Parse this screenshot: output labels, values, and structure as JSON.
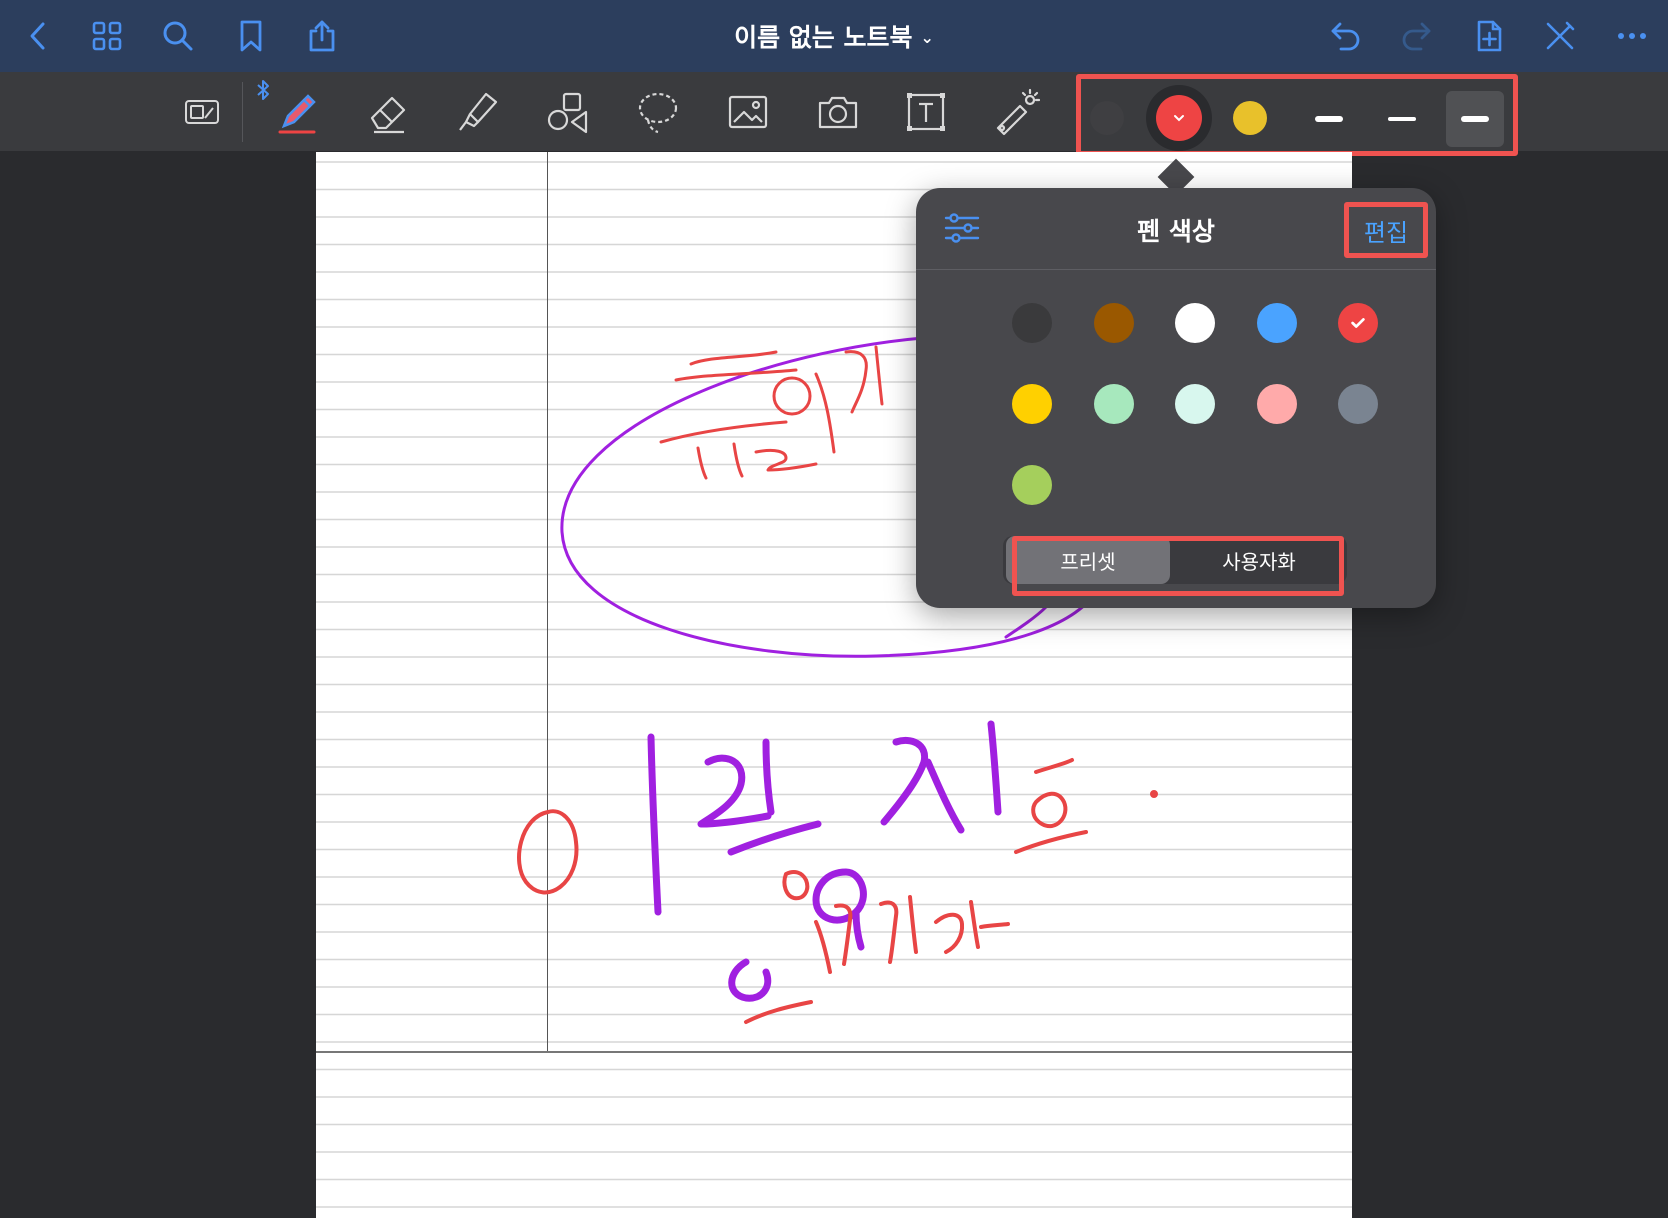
{
  "navbar": {
    "title": "이름 없는 노트북",
    "title_chevron": "⌄",
    "accent_color": "#4a90f0",
    "left_icons": [
      "back-chevron-icon",
      "thumbnails-grid-icon",
      "search-icon",
      "bookmark-icon",
      "share-icon"
    ],
    "right_icons": [
      "undo-icon",
      "redo-icon",
      "add-page-icon",
      "tools-edit-icon",
      "more-icon"
    ]
  },
  "toolbar": {
    "tools": [
      "zoom-window-icon",
      "pen-icon",
      "eraser-icon",
      "highlighter-icon",
      "shapes-icon",
      "lasso-icon",
      "image-icon",
      "camera-icon",
      "text-box-icon",
      "laser-pointer-icon"
    ],
    "bluetooth_icon": "bluetooth-icon",
    "quick_colors": [
      "#3f3f42",
      "#ee4444",
      "#e8c12b"
    ],
    "selected_color_index": 1,
    "stroke_widths": [
      "thin",
      "medium",
      "thick"
    ],
    "selected_stroke_index": 2
  },
  "popover": {
    "title": "펜 색상",
    "edit_label": "편집",
    "swatches": [
      "#3a3a3c",
      "#9a5800",
      "#ffffff",
      "#4aa3ff",
      "#ee4444",
      "#ffd000",
      "#a7e8bd",
      "#d8f7ee",
      "#ffaaaa",
      "#7a8491",
      "#a5cf5c"
    ],
    "selected_swatch_index": 4,
    "segments": [
      "프리셋",
      "사용자화"
    ],
    "active_segment_index": 0
  }
}
